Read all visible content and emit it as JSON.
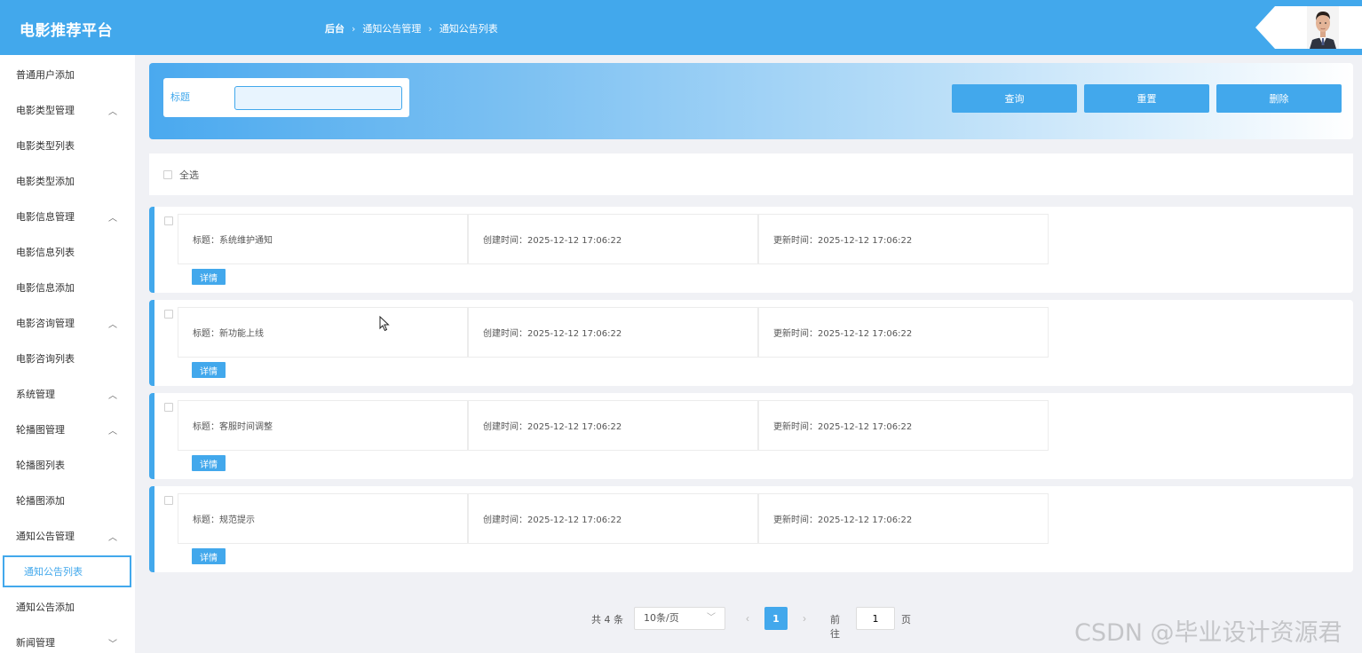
{
  "header": {
    "app_title": "电影推荐平台",
    "breadcrumb": [
      "后台",
      "通知公告管理",
      "通知公告列表"
    ]
  },
  "sidebar": {
    "items": [
      {
        "label": "普通用户添加",
        "expandable": false
      },
      {
        "label": "电影类型管理",
        "expandable": true
      },
      {
        "label": "电影类型列表",
        "expandable": false
      },
      {
        "label": "电影类型添加",
        "expandable": false
      },
      {
        "label": "电影信息管理",
        "expandable": true
      },
      {
        "label": "电影信息列表",
        "expandable": false
      },
      {
        "label": "电影信息添加",
        "expandable": false
      },
      {
        "label": "电影咨询管理",
        "expandable": true
      },
      {
        "label": "电影咨询列表",
        "expandable": false
      },
      {
        "label": "系统管理",
        "expandable": true
      },
      {
        "label": "轮播图管理",
        "expandable": true
      },
      {
        "label": "轮播图列表",
        "expandable": false
      },
      {
        "label": "轮播图添加",
        "expandable": false
      },
      {
        "label": "通知公告管理",
        "expandable": true
      },
      {
        "label": "通知公告列表",
        "expandable": false,
        "active": true
      },
      {
        "label": "通知公告添加",
        "expandable": false
      },
      {
        "label": "新闻管理",
        "expandable": true,
        "collapsed": true
      }
    ]
  },
  "search": {
    "label": "标题",
    "value": "",
    "buttons": {
      "query": "查询",
      "reset": "重置",
      "delete": "删除"
    }
  },
  "list": {
    "select_all": "全选",
    "detail_label": "详情",
    "items": [
      {
        "title": "标题：系统维护通知",
        "created": "创建时间：2025-12-12 17:06:22",
        "updated": "更新时间：2025-12-12 17:06:22"
      },
      {
        "title": "标题：新功能上线",
        "created": "创建时间：2025-12-12 17:06:22",
        "updated": "更新时间：2025-12-12 17:06:22"
      },
      {
        "title": "标题：客服时间调整",
        "created": "创建时间：2025-12-12 17:06:22",
        "updated": "更新时间：2025-12-12 17:06:22"
      },
      {
        "title": "标题：规范提示",
        "created": "创建时间：2025-12-12 17:06:22",
        "updated": "更新时间：2025-12-12 17:06:22"
      }
    ]
  },
  "pagination": {
    "total": "共 4 条",
    "page_size": "10条/页",
    "current_page": "1",
    "goto_label": "前往",
    "goto_value": "1",
    "page_unit": "页"
  },
  "watermark": "CSDN @毕业设计资源君",
  "colors": {
    "primary": "#42a8ec",
    "background": "#f0f1f5"
  },
  "icons": [
    "chevron-up-icon",
    "chevron-down-icon",
    "chevron-left-icon",
    "chevron-right-icon",
    "checkbox-icon",
    "mouse-cursor-icon",
    "user-avatar"
  ]
}
